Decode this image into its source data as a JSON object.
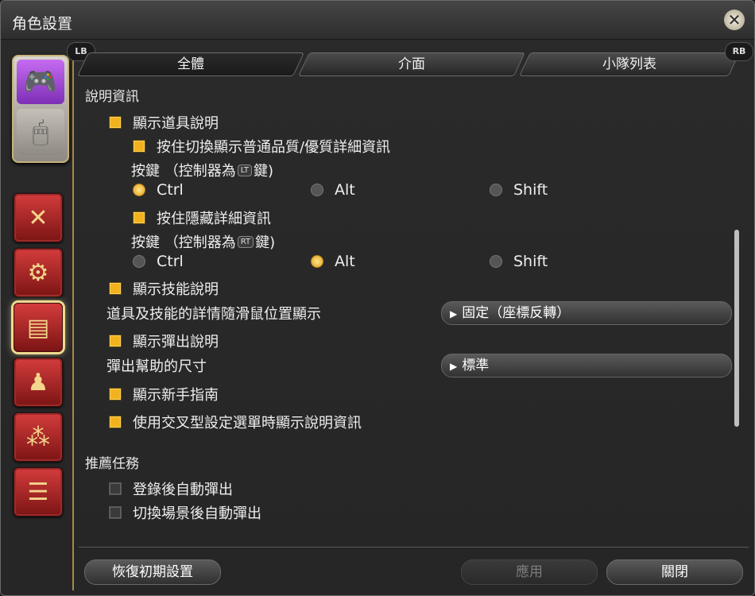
{
  "window": {
    "title": "角色設置"
  },
  "icons": {
    "close": "close-icon",
    "gamepad": "gamepad-icon",
    "mouse": "mouse-icon",
    "sidebar": [
      "crossed-arrows-icon",
      "gear-bag-icon",
      "id-card-icon",
      "character-icon",
      "pattern-icon",
      "chat-icon"
    ]
  },
  "tabs": {
    "lb": "LB",
    "rb": "RB",
    "items": [
      "全體",
      "介面",
      "小隊列表"
    ]
  },
  "settings": {
    "section_help": "說明資訊",
    "item_help": "顯示道具說明",
    "hold_switch": "按住切換顯示普通品質/優質詳細資訊",
    "key1_prefix": "按鍵 （控制器為",
    "key1_badge": "LT",
    "key1_suffix": "鍵)",
    "radios1": [
      "Ctrl",
      "Alt",
      "Shift"
    ],
    "hold_hide": "按住隱藏詳細資訊",
    "key2_prefix": "按鍵 （控制器為",
    "key2_badge": "RT",
    "key2_suffix": "鍵)",
    "radios2": [
      "Ctrl",
      "Alt",
      "Shift"
    ],
    "skill_help": "顯示技能說明",
    "detail_pos_label": "道具及技能的詳情隨滑鼠位置顯示",
    "detail_pos_value": "固定（座標反轉）",
    "popup_help": "顯示彈出說明",
    "popup_size_label": "彈出幫助的尺寸",
    "popup_size_value": "標準",
    "novice_guide": "顯示新手指南",
    "cross_menu_help": "使用交叉型設定選單時顯示說明資訊",
    "section_quest": "推薦任務",
    "quest_login": "登錄後自動彈出",
    "quest_scene": "切換場景後自動彈出"
  },
  "footer": {
    "reset": "恢復初期設置",
    "apply": "應用",
    "close": "關閉"
  },
  "colors": {
    "accent": "#f2b21d",
    "frame": "#a8874a",
    "sidebar_red": "#b52a2a"
  }
}
